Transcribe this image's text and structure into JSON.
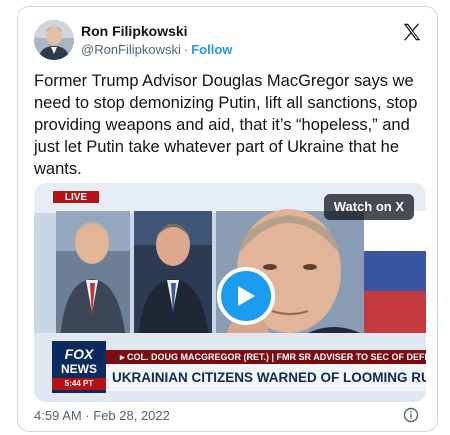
{
  "header": {
    "display_name": "Ron Filipkowski",
    "handle": "@RonFilipkowski",
    "separator": "·",
    "follow_label": "Follow"
  },
  "tweet": {
    "text": "Former Trump Advisor Douglas MacGregor says we need to stop demonizing Putin, lift all sanctions, stop providing weapons and aid, that it’s “hopeless,” and just let Putin take whatever part of Ukraine that he wants."
  },
  "media": {
    "watch_label": "Watch on X",
    "live_label": "LIVE",
    "chyron_top": "▸ COL. DOUG MACGREGOR (RET.) | FMR SR ADVISER TO SEC OF DEFENSE",
    "chyron_main": "UKRAINIAN CITIZENS WARNED OF LOOMING RUSSIAN SIEGE",
    "network_logo_line1": "FOX",
    "network_logo_line2": "NEWS",
    "network_time": "5:44 PT"
  },
  "footer": {
    "timestamp": "4:59 AM · Feb 28, 2022"
  },
  "colors": {
    "accent": "#1d9bf0",
    "text": "#0f1419",
    "muted": "#536471",
    "border": "#cfd9de"
  },
  "icons": [
    "x-logo-icon",
    "play-icon",
    "info-icon"
  ]
}
